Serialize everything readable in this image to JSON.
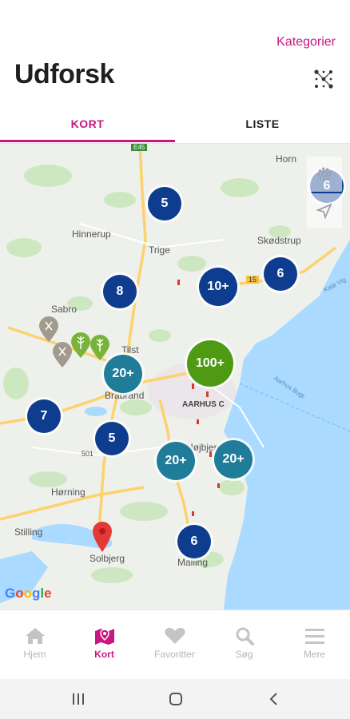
{
  "header": {
    "categories_link": "Kategorier",
    "title": "Udforsk",
    "filter_icon": "filter-network-icon"
  },
  "tabs": [
    {
      "label": "KORT",
      "active": true
    },
    {
      "label": "LISTE",
      "active": false
    }
  ],
  "map": {
    "places": {
      "horn": "Horn",
      "hinnerup": "Hinnerup",
      "trige": "Trige",
      "skodstrup": "Skødstrup",
      "sabro": "Sabro",
      "tilst": "Tilst",
      "brabrand": "Brabrand",
      "aarhus": "AARHUS C",
      "hojbjerg": "Højbjerg",
      "horning": "Hørning",
      "stilling": "Stilling",
      "solbjerg": "Solbjerg",
      "malling": "Malling",
      "aarhus_bugt": "Aarhus Bugt",
      "kalo_vig": "Kalø Vig",
      "road_15": "15",
      "road_e45": "E45",
      "road_501": "501"
    },
    "clusters": {
      "c1": "5",
      "c2": "6",
      "c3": "8",
      "c4": "10+",
      "c5": "6",
      "c6": "100+",
      "c7": "20+",
      "c8": "7",
      "c9": "5",
      "c10": "20+",
      "c11": "20+",
      "c12": "6"
    },
    "google_logo": [
      "G",
      "o",
      "o",
      "g",
      "l",
      "e"
    ],
    "cluster_colors": {
      "blue": "#0e3d8f",
      "teal": "#1f7d99",
      "green": "#4e9a12"
    }
  },
  "bottom_nav": [
    {
      "label": "Hjem",
      "icon": "home-icon",
      "active": false
    },
    {
      "label": "Kort",
      "icon": "map-icon",
      "active": true
    },
    {
      "label": "Favoritter",
      "icon": "heart-icon",
      "active": false
    },
    {
      "label": "Søg",
      "icon": "search-icon",
      "active": false
    },
    {
      "label": "Mere",
      "icon": "menu-icon",
      "active": false
    }
  ],
  "accent_color": "#c8177f"
}
